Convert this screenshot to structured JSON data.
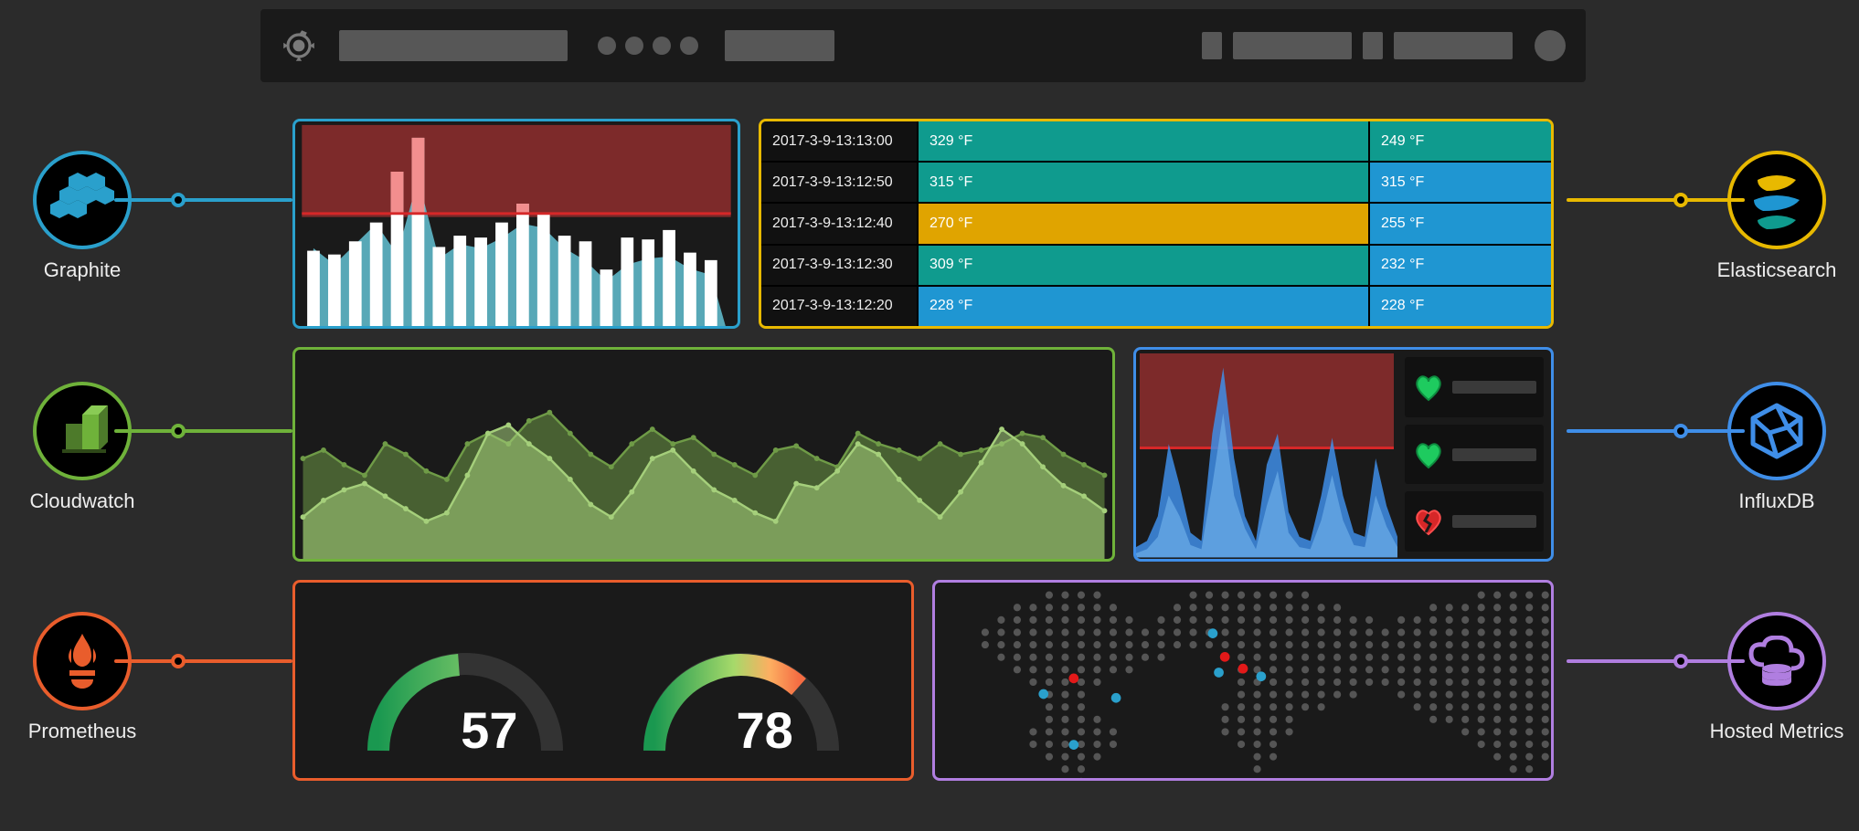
{
  "datasources": {
    "left": [
      {
        "name": "Graphite",
        "color": "#2aa0cc"
      },
      {
        "name": "Cloudwatch",
        "color": "#6fb23a"
      },
      {
        "name": "Prometheus",
        "color": "#e95d2c"
      }
    ],
    "right": [
      {
        "name": "Elasticsearch",
        "color": "#e8b900"
      },
      {
        "name": "InfluxDB",
        "color": "#3f8ee8"
      },
      {
        "name": "Hosted Metrics",
        "color": "#b07ee0"
      }
    ]
  },
  "panels": {
    "bar_chart": {
      "border": "#2aa0cc"
    },
    "table": {
      "border": "#e8b900"
    },
    "area_chart": {
      "border": "#6fb23a"
    },
    "alert_chart": {
      "border": "#3f8ee8"
    },
    "gauges": {
      "border": "#e95d2c"
    },
    "worldmap": {
      "border": "#b07ee0"
    }
  },
  "table_rows": [
    {
      "ts": "2017-3-9-13:13:00",
      "v1": "329 °F",
      "c1": "teal",
      "v2": "249 °F",
      "c2": "teal"
    },
    {
      "ts": "2017-3-9-13:12:50",
      "v1": "315 °F",
      "c1": "teal",
      "v2": "315 °F",
      "c2": "blue"
    },
    {
      "ts": "2017-3-9-13:12:40",
      "v1": "270 °F",
      "c1": "amber",
      "v2": "255 °F",
      "c2": "blue"
    },
    {
      "ts": "2017-3-9-13:12:30",
      "v1": "309 °F",
      "c1": "teal",
      "v2": "232 °F",
      "c2": "blue"
    },
    {
      "ts": "2017-3-9-13:12:20",
      "v1": "228 °F",
      "c1": "blue",
      "v2": "228 °F",
      "c2": "blue"
    }
  ],
  "gauges": [
    {
      "value": "57"
    },
    {
      "value": "78"
    }
  ],
  "hearts": [
    {
      "state": "ok"
    },
    {
      "state": "ok"
    },
    {
      "state": "broken"
    }
  ],
  "chart_data": {
    "bar_chart": {
      "type": "bar",
      "threshold_fraction": 0.55,
      "series": [
        {
          "name": "area_back",
          "values": [
            38,
            30,
            40,
            50,
            35,
            72,
            33,
            40,
            38,
            43,
            50,
            48,
            38,
            32,
            22,
            30,
            33,
            34,
            28,
            25
          ]
        },
        {
          "name": "bars",
          "values": [
            40,
            38,
            45,
            55,
            82,
            100,
            42,
            48,
            47,
            55,
            65,
            60,
            48,
            45,
            30,
            47,
            46,
            51,
            39,
            35
          ]
        }
      ]
    },
    "table": {
      "type": "table",
      "columns": [
        "timestamp",
        "temp_a",
        "temp_b"
      ],
      "rows": [
        [
          "2017-3-9-13:13:00",
          329,
          249
        ],
        [
          "2017-3-9-13:12:50",
          315,
          315
        ],
        [
          "2017-3-9-13:12:40",
          270,
          255
        ],
        [
          "2017-3-9-13:12:30",
          309,
          232
        ],
        [
          "2017-3-9-13:12:20",
          228,
          228
        ]
      ],
      "unit": "°F"
    },
    "area_chart": {
      "type": "area",
      "ylim": [
        0,
        100
      ],
      "series": [
        {
          "name": "series_a",
          "color": "#6f9b47",
          "values": [
            48,
            52,
            45,
            40,
            55,
            50,
            42,
            38,
            55,
            60,
            55,
            66,
            70,
            60,
            50,
            44,
            55,
            62,
            55,
            58,
            50,
            45,
            40,
            52,
            54,
            48,
            44,
            60,
            55,
            52,
            48,
            55,
            50,
            52,
            55,
            60,
            58,
            50,
            45,
            40
          ]
        },
        {
          "name": "series_b",
          "color": "#a5cf7b",
          "values": [
            20,
            28,
            33,
            36,
            30,
            24,
            18,
            22,
            40,
            60,
            64,
            55,
            48,
            38,
            26,
            20,
            32,
            48,
            52,
            42,
            33,
            28,
            22,
            18,
            36,
            34,
            42,
            55,
            50,
            38,
            28,
            20,
            32,
            46,
            62,
            55,
            44,
            35,
            30,
            23
          ]
        }
      ]
    },
    "alert_chart": {
      "type": "area",
      "threshold_fraction": 0.54,
      "series": [
        {
          "name": "alert_a",
          "color": "#3f8ee8",
          "values": [
            5,
            8,
            20,
            55,
            35,
            12,
            8,
            60,
            92,
            48,
            20,
            8,
            45,
            60,
            22,
            10,
            8,
            30,
            58,
            30,
            12,
            10,
            48,
            25,
            10
          ]
        },
        {
          "name": "alert_b",
          "color": "#6caee8",
          "values": [
            2,
            4,
            10,
            30,
            20,
            6,
            4,
            35,
            70,
            30,
            14,
            4,
            25,
            42,
            12,
            5,
            4,
            18,
            40,
            18,
            6,
            5,
            30,
            15,
            5
          ]
        }
      ]
    },
    "gauges": {
      "type": "gauge",
      "range": [
        0,
        100
      ],
      "values": [
        57,
        78
      ]
    },
    "worldmap": {
      "type": "map",
      "highlights": [
        {
          "x": 0.17,
          "y": 0.57,
          "color": "#2aa0cc"
        },
        {
          "x": 0.22,
          "y": 0.49,
          "color": "#e31919"
        },
        {
          "x": 0.47,
          "y": 0.38,
          "color": "#e31919"
        },
        {
          "x": 0.5,
          "y": 0.44,
          "color": "#e31919"
        },
        {
          "x": 0.46,
          "y": 0.46,
          "color": "#2aa0cc"
        },
        {
          "x": 0.53,
          "y": 0.48,
          "color": "#2aa0cc"
        },
        {
          "x": 0.22,
          "y": 0.83,
          "color": "#2aa0cc"
        },
        {
          "x": 0.45,
          "y": 0.26,
          "color": "#2aa0cc"
        },
        {
          "x": 0.29,
          "y": 0.59,
          "color": "#2aa0cc"
        }
      ]
    }
  }
}
